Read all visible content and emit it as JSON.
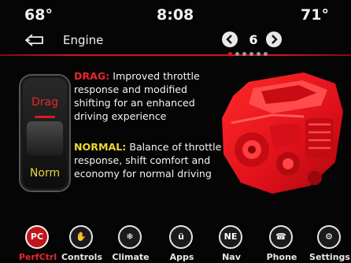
{
  "status": {
    "temp_left": "68°",
    "time": "8:08",
    "temp_right": "71°"
  },
  "header": {
    "title": "Engine",
    "page": "6"
  },
  "pager": {
    "dots": 6,
    "active_index": 0
  },
  "mode_switch": {
    "top_label": "Drag",
    "bottom_label": "Norm"
  },
  "drag": {
    "key": "DRAG:",
    "text": "Improved throttle response and modified shifting for an enhanced driving experience"
  },
  "normal": {
    "key": "NORMAL:",
    "text": "Balance of throttle response, shift comfort and economy for normal driving"
  },
  "nav": [
    {
      "label": "PerfCtrl",
      "icon": "perf-control-icon",
      "glyph": "PC",
      "active": true
    },
    {
      "label": "Controls",
      "icon": "controls-hand-icon",
      "glyph": "✋",
      "active": false
    },
    {
      "label": "Climate",
      "icon": "climate-fan-icon",
      "glyph": "❄",
      "active": false
    },
    {
      "label": "Apps",
      "icon": "apps-icon",
      "glyph": "ü",
      "active": false
    },
    {
      "label": "Nav",
      "icon": "compass-icon",
      "glyph": "NE",
      "active": false
    },
    {
      "label": "Phone",
      "icon": "phone-icon",
      "glyph": "☎",
      "active": false
    },
    {
      "label": "Settings",
      "icon": "gear-icon",
      "glyph": "⚙",
      "active": false
    }
  ],
  "colors": {
    "accent_red": "#e0191f",
    "normal_yellow": "#f2d530"
  }
}
